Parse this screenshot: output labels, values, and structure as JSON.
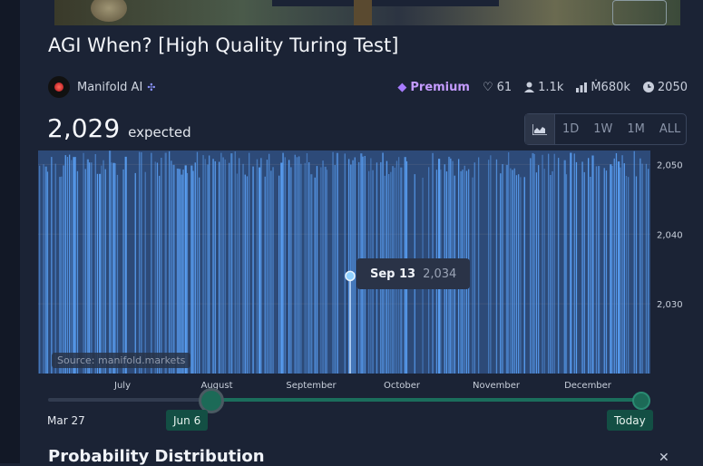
{
  "title": "AGI When? [High Quality Turing Test]",
  "creator": {
    "name": "Manifold AI",
    "badge_icon": "bot-icon"
  },
  "stats": {
    "premium_label": "Premium",
    "likes": "61",
    "traders": "1.1k",
    "volume": "Ṁ680k",
    "close_year": "2050"
  },
  "expected": {
    "value": "2,029",
    "label": "expected"
  },
  "range_buttons": [
    {
      "label": "",
      "icon": "chart-icon"
    },
    {
      "label": "1D"
    },
    {
      "label": "1W"
    },
    {
      "label": "1M"
    },
    {
      "label": "ALL"
    }
  ],
  "chart_data": {
    "type": "area",
    "y_ticks": [
      "2,050",
      "2,040",
      "2,030"
    ],
    "x_ticks": [
      "July",
      "August",
      "September",
      "October",
      "November",
      "December"
    ],
    "ylim": [
      2020,
      2052
    ],
    "source": "Source: manifold.markets",
    "tooltip": {
      "date": "Sep 13",
      "value": "2,034"
    },
    "colors": {
      "fill": "#2d4a78",
      "bars": "#5aa0f5",
      "accent": "#8fd0ff"
    }
  },
  "slider": {
    "start_label": "Mar 27",
    "selected_start": "Jun 6",
    "selected_end": "Today"
  },
  "section": {
    "title": "Probability Distribution"
  }
}
